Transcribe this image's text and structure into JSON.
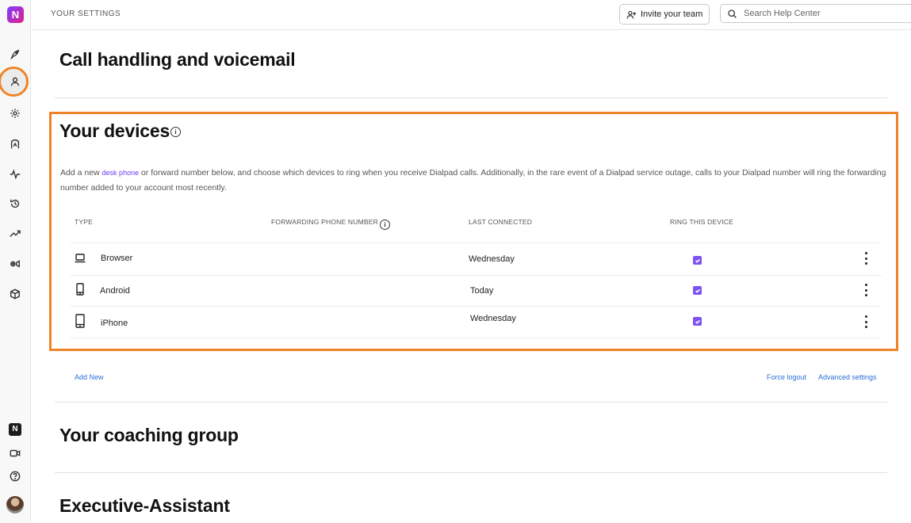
{
  "app": {
    "logo_text": "N",
    "bottom_logo_text": "N"
  },
  "rail": {
    "items": [
      {
        "icon": "rocket-icon"
      },
      {
        "icon": "user-icon",
        "active": true
      },
      {
        "icon": "gear-icon"
      },
      {
        "icon": "contact-center-icon"
      },
      {
        "icon": "activity-icon"
      },
      {
        "icon": "history-icon"
      },
      {
        "icon": "trending-icon"
      },
      {
        "icon": "camera-settings-icon"
      },
      {
        "icon": "box-icon"
      }
    ],
    "bottom": [
      {
        "icon": "app-logo-icon"
      },
      {
        "icon": "video-icon"
      },
      {
        "icon": "help-icon"
      },
      {
        "icon": "avatar"
      }
    ]
  },
  "topbar": {
    "breadcrumb": "YOUR SETTINGS",
    "invite_label": "Invite your team",
    "search_placeholder": "Search Help Center"
  },
  "sections": {
    "call_handling": "Call handling and voicemail",
    "devices_title": "Your devices",
    "coaching": "Your coaching group",
    "executive": "Executive-Assistant"
  },
  "devices": {
    "desc_prefix": "Add a new",
    "desc_link": "desk phone",
    "desc_suffix": "or forward number below, and choose which devices to ring when you receive Dialpad calls. Additionally, in the rare event of a Dialpad service outage, calls to your Dialpad number will ring the forwarding number added to your account most recently.",
    "columns": {
      "type": "TYPE",
      "forwarding": "FORWARDING PHONE NUMBER",
      "last_connected": "LAST CONNECTED",
      "ring": "RING THIS DEVICE"
    },
    "rows": [
      {
        "type": "Browser",
        "icon": "laptop-icon",
        "last_connected": "Wednesday",
        "ring": true
      },
      {
        "type": "Android",
        "icon": "mobile-phone-icon",
        "last_connected": "Today",
        "ring": true
      },
      {
        "type": "iPhone",
        "icon": "mobile-phone-icon",
        "last_connected": "Wednesday",
        "ring": true
      }
    ],
    "add_new": "Add New",
    "force_logout": "Force logout",
    "advanced_settings": "Advanced settings"
  },
  "colors": {
    "accent": "#7c52f5",
    "highlight": "#f08327",
    "link": "#2a6fd6"
  }
}
